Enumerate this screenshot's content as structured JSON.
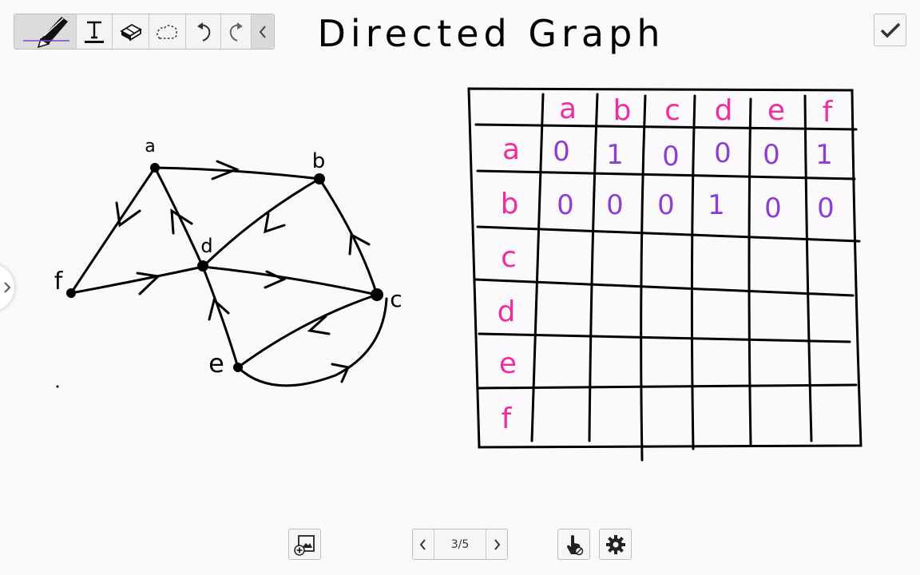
{
  "title": "Directed Graph",
  "graph": {
    "node_labels": [
      "a",
      "b",
      "c",
      "d",
      "e",
      "f"
    ]
  },
  "matrix": {
    "col_headers": [
      "a",
      "b",
      "c",
      "d",
      "e",
      "f"
    ],
    "rows": [
      {
        "label": "a",
        "values": [
          "0",
          "1",
          "0",
          "0",
          "0",
          "1"
        ]
      },
      {
        "label": "b",
        "values": [
          "0",
          "0",
          "0",
          "1",
          "0",
          "0"
        ]
      },
      {
        "label": "c",
        "values": []
      },
      {
        "label": "d",
        "values": []
      },
      {
        "label": "e",
        "values": []
      },
      {
        "label": "f",
        "values": []
      }
    ]
  },
  "pager": {
    "label": "3/5"
  },
  "colors": {
    "ink": "#000000",
    "header_ink": "#ee2e9f",
    "value_ink": "#8a3fd1",
    "pen_active": "#8a3fd1"
  },
  "icons": {
    "toolbar": [
      "pen-icon",
      "text-icon",
      "eraser-icon",
      "lasso-icon",
      "undo-icon",
      "redo-icon",
      "chevron-left-icon"
    ],
    "bottom": [
      "insert-image-icon",
      "chevron-left-icon",
      "chevron-right-icon",
      "pointer-icon",
      "gear-icon"
    ],
    "top_right": "checkmark-icon"
  }
}
